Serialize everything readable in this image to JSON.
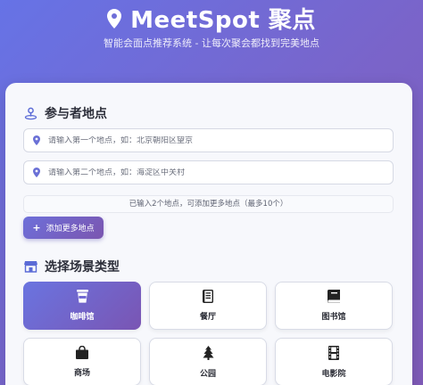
{
  "header": {
    "title": "MeetSpot 聚点",
    "subtitle": "智能会面点推荐系统 - 让每次聚会都找到完美地点"
  },
  "participants": {
    "section_title": "参与者地点",
    "inputs": [
      {
        "placeholder": "请输入第一个地点，如：北京朝阳区望京",
        "value": ""
      },
      {
        "placeholder": "请输入第二个地点，如：海淀区中关村",
        "value": ""
      }
    ],
    "hint": "已输入2个地点，可添加更多地点（最多10个）",
    "add_button": "添加更多地点"
  },
  "scenes": {
    "section_title": "选择场景类型",
    "items": [
      {
        "label": "咖啡馆",
        "icon": "coffee-cup-icon",
        "selected": true
      },
      {
        "label": "餐厅",
        "icon": "menu-book-icon",
        "selected": false
      },
      {
        "label": "图书馆",
        "icon": "book-icon",
        "selected": false
      },
      {
        "label": "商场",
        "icon": "shopping-bag-icon",
        "selected": false
      },
      {
        "label": "公园",
        "icon": "tree-icon",
        "selected": false
      },
      {
        "label": "电影院",
        "icon": "film-icon",
        "selected": false
      }
    ]
  },
  "colors": {
    "accent": "#6a74e0",
    "accent_end": "#7a55b3"
  }
}
